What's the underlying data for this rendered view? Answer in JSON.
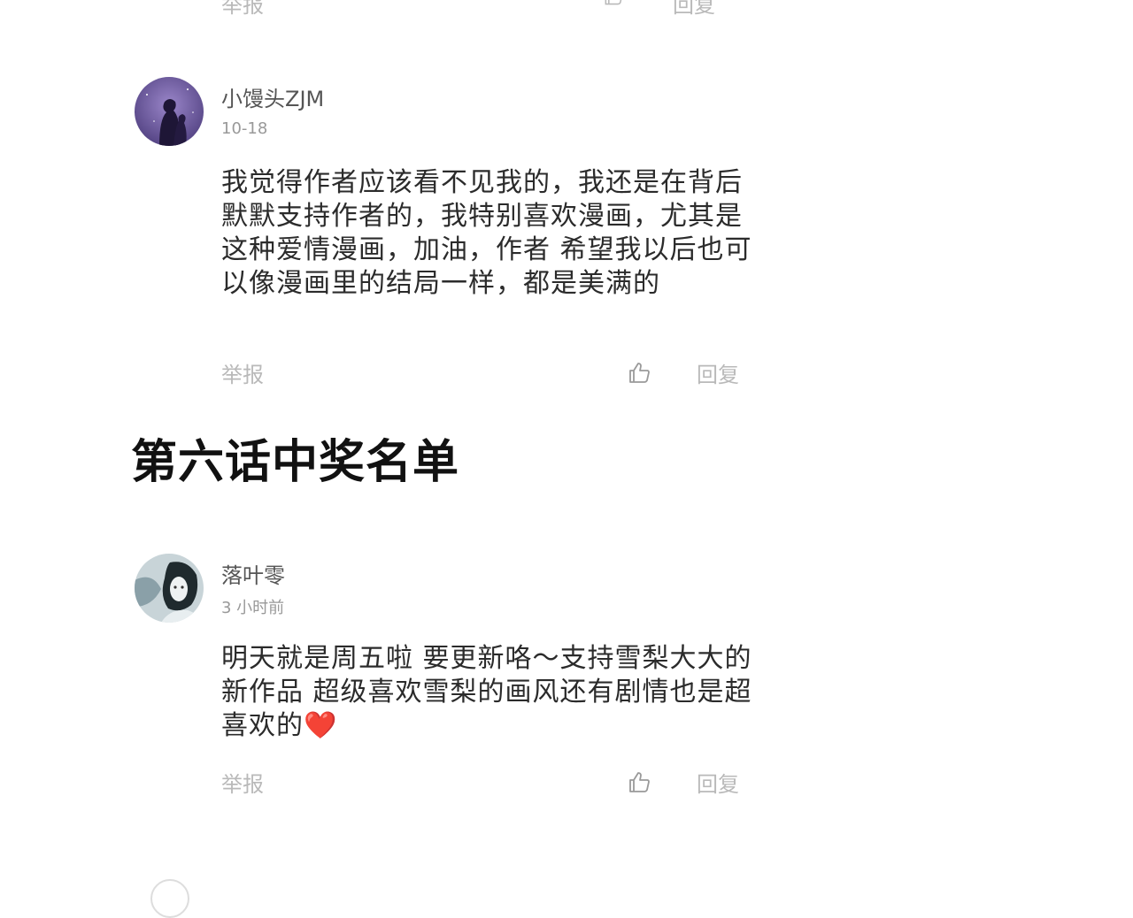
{
  "top_partial": {
    "report_label": "举报",
    "reply_label": "回复"
  },
  "comments": [
    {
      "username": "小馒头ZJM",
      "time": "10-18",
      "body": "我觉得作者应该看不见我的，我还是在背后默默支持作者的，我特别喜欢漫画，尤其是这种爱情漫画，加油，作者 希望我以后也可以像漫画里的结局一样，都是美满的",
      "report_label": "举报",
      "reply_label": "回复"
    },
    {
      "username": "落叶零",
      "time": "3 小时前",
      "body": " 明天就是周五啦 要更新咯～支持雪梨大大的新作品 超级喜欢雪梨的画风还有剧情也是超喜欢的",
      "body_emoji": "❤️",
      "report_label": "举报",
      "reply_label": "回复"
    }
  ],
  "section_title": "第六话中奖名单",
  "colors": {
    "muted": "#b9b9b9",
    "heart": "#e3242b"
  }
}
